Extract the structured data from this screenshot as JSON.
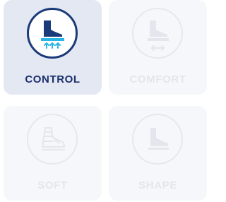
{
  "options": [
    {
      "key": "control",
      "label": "CONTROL",
      "icon": "foot-arch-arrows-icon",
      "active": true
    },
    {
      "key": "comfort",
      "label": "COMFORT",
      "icon": "foot-horizontal-arrows-icon",
      "active": false
    },
    {
      "key": "soft",
      "label": "SOFT",
      "icon": "sneaker-icon",
      "active": false
    },
    {
      "key": "shape",
      "label": "SHAPE",
      "icon": "foot-icon",
      "active": false
    }
  ],
  "colors": {
    "active_bg": "#e3e8f3",
    "active_ring": "#1b3a7a",
    "active_label": "#1b2f6b",
    "icon_navy": "#1b3a7a",
    "icon_cyan": "#29b6e6",
    "inactive_bg": "#f6f7fa",
    "inactive_glyph": "#e3e6ec"
  }
}
